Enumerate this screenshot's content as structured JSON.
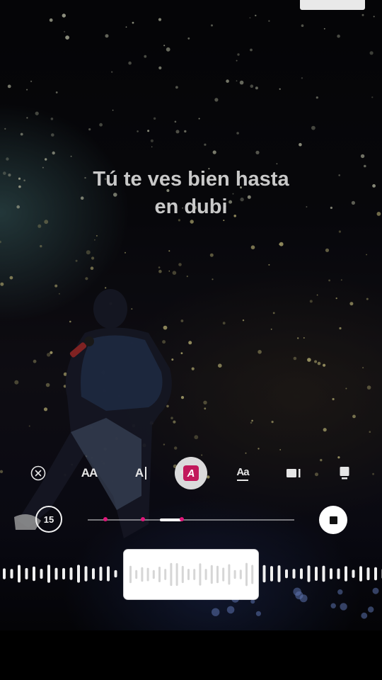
{
  "lyrics": {
    "line1": "Tú te ves bien hasta",
    "line2": "en dubi"
  },
  "toolbar": {
    "tools": [
      {
        "name": "close",
        "icon": "close-circle-icon"
      },
      {
        "name": "style-plain",
        "icon": "text-style-icon",
        "label": "AA"
      },
      {
        "name": "style-cursor",
        "icon": "text-cursor-style-icon",
        "label": "A"
      },
      {
        "name": "style-highlight",
        "icon": "text-highlight-style-icon",
        "label": "A",
        "selected": true
      },
      {
        "name": "style-underline",
        "icon": "text-underline-style-icon",
        "label": "Aa"
      },
      {
        "name": "style-box",
        "icon": "text-box-style-icon"
      },
      {
        "name": "style-card",
        "icon": "text-card-style-icon"
      }
    ],
    "accent_color": "#c2185b"
  },
  "timeline": {
    "clip_length_label": "15",
    "markers": 3,
    "selected_fraction_start": 0.35,
    "selected_fraction_end": 0.46
  },
  "controls": {
    "stop_icon": "stop-icon"
  }
}
